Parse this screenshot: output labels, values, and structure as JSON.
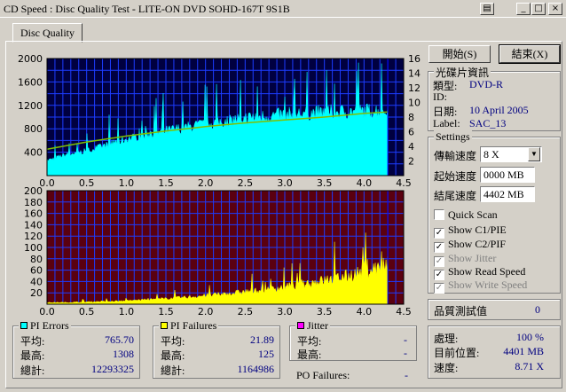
{
  "window": {
    "title": "CD Speed : Disc Quality Test - LITE-ON DVD SOHD-167T   9S1B",
    "controls": {
      "extra": "▤",
      "minimize": "_",
      "maximize": "□",
      "close": "×"
    }
  },
  "tab": {
    "label": "Disc Quality"
  },
  "buttons": {
    "start": "開始(S)",
    "end": "結束(X)"
  },
  "disc_info": {
    "title": "光碟片資訊",
    "type_label": "類型:",
    "type_value": "DVD-R",
    "id_label": "ID:",
    "id_value": "",
    "date_label": "日期:",
    "date_value": "10 April 2005",
    "label_label": "Label:",
    "label_value": "SAC_13"
  },
  "settings": {
    "title": "Settings",
    "speed_label": "傳輸速度",
    "speed_value": "8 X",
    "start_label": "起始速度",
    "start_value": "0000 MB",
    "end_label": "結尾速度",
    "end_value": "4402 MB",
    "quick_scan": "Quick Scan",
    "show_c1pie": "Show C1/PIE",
    "show_c2pif": "Show C2/PIF",
    "show_jitter": "Show Jitter",
    "show_read_speed": "Show Read Speed",
    "show_write_speed": "Show Write Speed",
    "check_mark": "✓",
    "dropdown_arrow": "▼"
  },
  "quality": {
    "label": "品質測試值",
    "value": "0"
  },
  "progress": {
    "processing_label": "處理:",
    "processing_value": "100 %",
    "position_label": "目前位置:",
    "position_value": "4401 MB",
    "speed_label": "速度:",
    "speed_value": "8.71 X"
  },
  "pi_errors": {
    "title": "PI Errors",
    "color": "#00ffff",
    "avg_label": "平均:",
    "avg": "765.70",
    "max_label": "最高:",
    "max": "1308",
    "total_label": "總計:",
    "total": "12293325"
  },
  "pi_failures": {
    "title": "PI Failures",
    "color": "#ffff00",
    "avg_label": "平均:",
    "avg": "21.89",
    "max_label": "最高:",
    "max": "125",
    "total_label": "總計:",
    "total": "1164986"
  },
  "jitter": {
    "title": "Jitter",
    "color": "#ff00ff",
    "avg_label": "平均:",
    "avg": "-",
    "max_label": "最高:",
    "max": "-"
  },
  "po_failures": {
    "label": "PO Failures:",
    "value": "-"
  },
  "chart_data": [
    {
      "type": "area",
      "series": [
        {
          "name": "PI Errors",
          "color": "#00ffff",
          "x": [
            0.0,
            0.25,
            0.5,
            0.75,
            1.0,
            1.25,
            1.5,
            1.75,
            2.0,
            2.25,
            2.5,
            2.75,
            3.0,
            3.25,
            3.5,
            3.75,
            4.0,
            4.3
          ],
          "values": [
            260,
            360,
            420,
            520,
            620,
            700,
            760,
            820,
            880,
            930,
            980,
            1010,
            1040,
            1060,
            1080,
            1090,
            1100,
            1120
          ]
        },
        {
          "name": "Read Speed",
          "color": "#80c000",
          "x": [
            0.0,
            0.5,
            1.0,
            1.5,
            2.0,
            2.5,
            3.0,
            3.5,
            4.0,
            4.3
          ],
          "values": [
            3.6,
            4.6,
            5.4,
            6.1,
            6.7,
            7.2,
            7.6,
            8.0,
            8.5,
            8.7
          ]
        }
      ],
      "xlim": [
        0,
        4.5
      ],
      "ylim": [
        0,
        2000
      ],
      "y2lim": [
        0,
        16
      ],
      "x_ticks": [
        "0.0",
        "0.5",
        "1.0",
        "1.5",
        "2.0",
        "2.5",
        "3.0",
        "3.5",
        "4.0",
        "4.5"
      ],
      "y_ticks": [
        "400",
        "800",
        "1200",
        "1600",
        "2000"
      ],
      "y2_ticks": [
        "2",
        "4",
        "6",
        "8",
        "10",
        "12",
        "14",
        "16"
      ],
      "grid": true
    },
    {
      "type": "area",
      "series": [
        {
          "name": "PI Failures",
          "color": "#ffff00",
          "x": [
            0.0,
            0.25,
            0.5,
            0.75,
            1.0,
            1.25,
            1.5,
            1.75,
            2.0,
            2.25,
            2.5,
            2.75,
            3.0,
            3.25,
            3.5,
            3.75,
            4.0,
            4.3
          ],
          "values": [
            3,
            3,
            4,
            5,
            6,
            8,
            10,
            12,
            15,
            18,
            22,
            26,
            30,
            36,
            42,
            48,
            58,
            68
          ]
        }
      ],
      "xlim": [
        0,
        4.5
      ],
      "ylim": [
        0,
        200
      ],
      "x_ticks": [
        "0.0",
        "0.5",
        "1.0",
        "1.5",
        "2.0",
        "2.5",
        "3.0",
        "3.5",
        "4.0",
        "4.5"
      ],
      "y_ticks": [
        "20",
        "40",
        "60",
        "80",
        "100",
        "120",
        "140",
        "160",
        "180",
        "200"
      ],
      "grid": true
    }
  ]
}
